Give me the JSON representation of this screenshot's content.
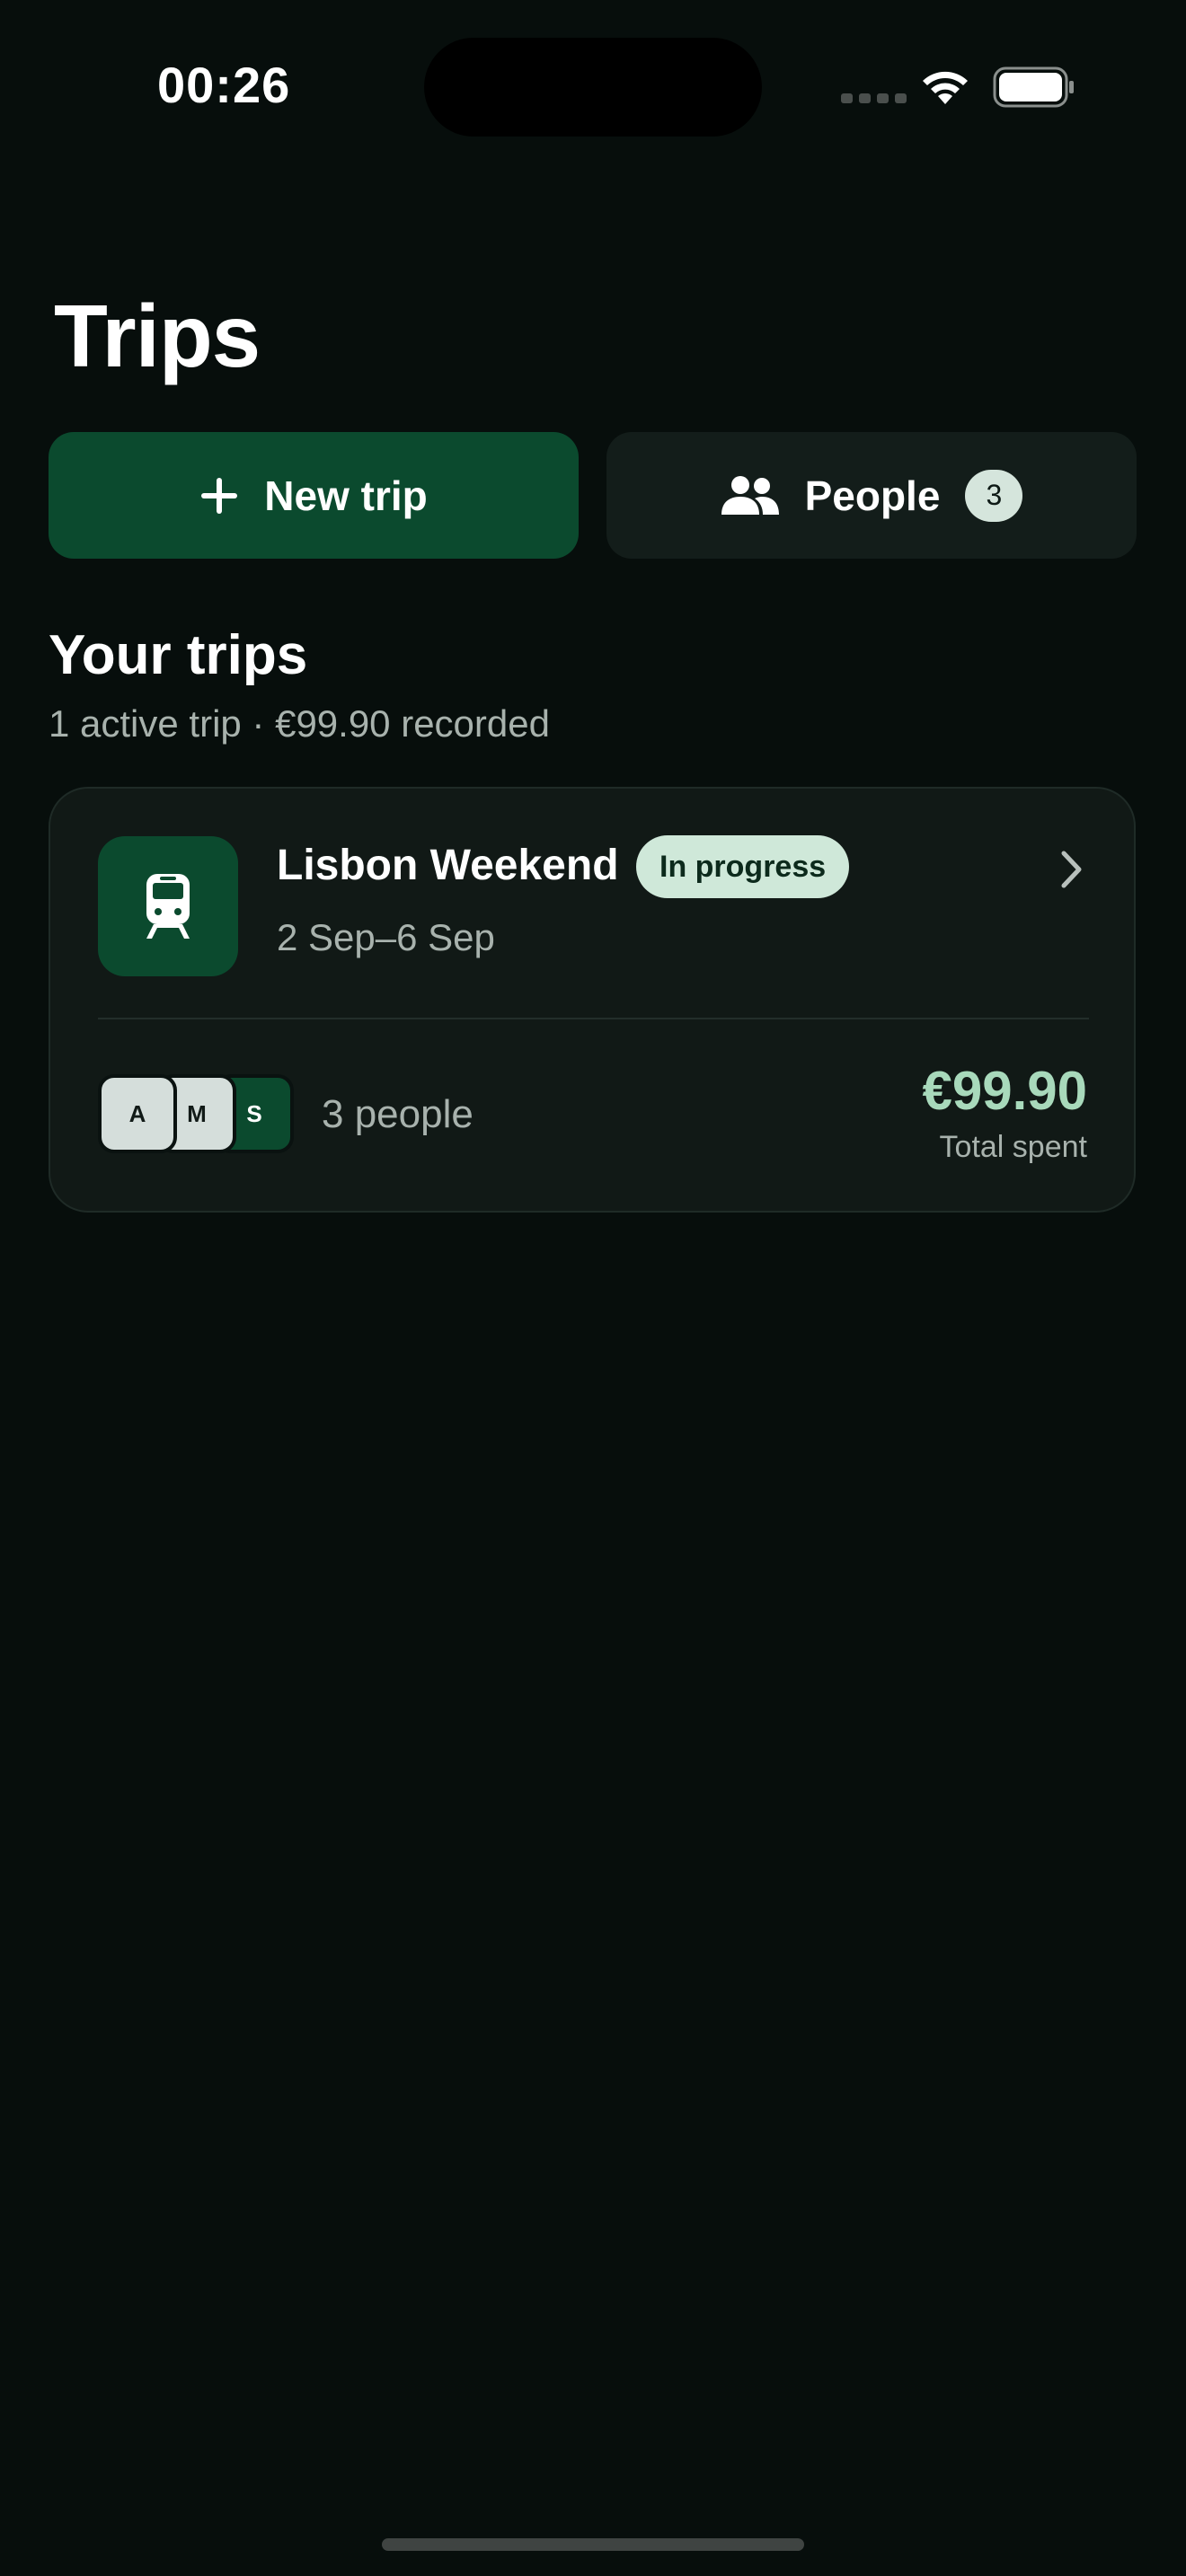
{
  "status_bar": {
    "time": "00:26"
  },
  "header": {
    "title": "Trips"
  },
  "actions": {
    "new_trip_label": "New trip",
    "people_label": "People",
    "people_count": "3"
  },
  "trips_section": {
    "title": "Your trips",
    "subtitle": "1 active trip · €99.90 recorded"
  },
  "trips": [
    {
      "icon": "train-icon",
      "name": "Lisbon Weekend",
      "status": "In progress",
      "dates": "2 Sep–6 Sep",
      "members": [
        "A",
        "M",
        "S"
      ],
      "people_label": "3 people",
      "total": "€99.90",
      "total_label": "Total spent"
    }
  ],
  "colors": {
    "background": "#070e0c",
    "accent": "#0b4a2e",
    "accent_light": "#cfe8d9",
    "amount": "#a8d9bb"
  }
}
